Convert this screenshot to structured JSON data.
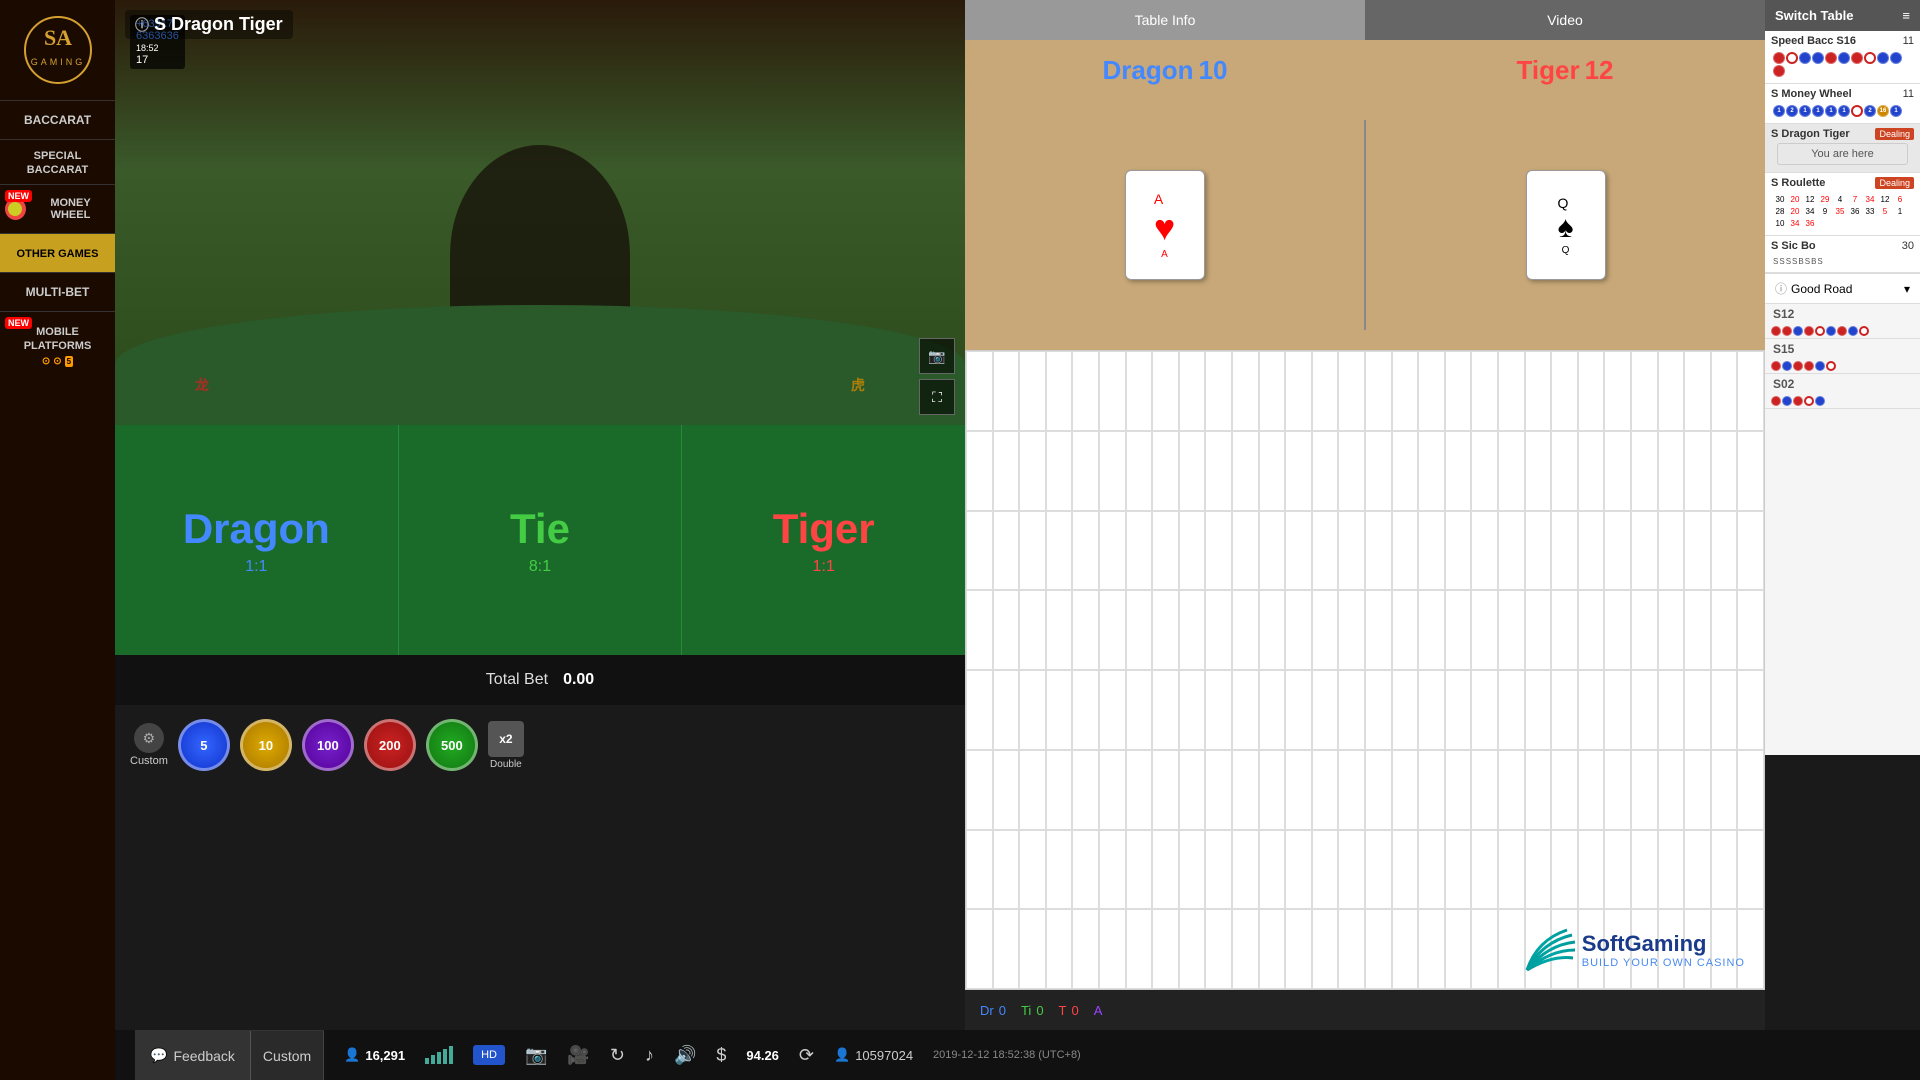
{
  "sidebar": {
    "logo": "SA",
    "logo_sub": "GAMING",
    "nav_items": [
      {
        "id": "baccarat",
        "label": "BACCARAT",
        "active": false
      },
      {
        "id": "special-baccarat",
        "label": "SPECIAL BACCARAT",
        "active": false
      },
      {
        "id": "money-wheel",
        "label": "MONEY WHEEL",
        "active": false,
        "badge": "NEW"
      },
      {
        "id": "other-games",
        "label": "OTHER GAMES",
        "active": true
      },
      {
        "id": "multi-bet",
        "label": "MULTI-BET",
        "active": false
      },
      {
        "id": "mobile-platforms",
        "label": "MOBILE PLATFORMS",
        "active": false,
        "badge": "NEW"
      }
    ]
  },
  "game": {
    "title": "S Dragon Tiger",
    "dragon_score": 10,
    "tiger_score": 12,
    "dragon_card": "♥",
    "tiger_card": "♛",
    "dragon_card_color": "red",
    "tiger_card_color": "black"
  },
  "betting": {
    "dragon_label": "Dragon",
    "dragon_odds": "1:1",
    "tie_label": "Tie",
    "tie_odds": "8:1",
    "tiger_label": "Tiger",
    "tiger_odds": "1:1",
    "total_bet_label": "Total Bet",
    "total_bet_value": "0.00"
  },
  "chips": [
    {
      "value": "5",
      "class": "chip-5"
    },
    {
      "value": "10",
      "class": "chip-10"
    },
    {
      "value": "100",
      "class": "chip-100"
    },
    {
      "value": "200",
      "class": "chip-200"
    },
    {
      "value": "500",
      "class": "chip-500"
    }
  ],
  "scores": {
    "dr_label": "Dr",
    "dr_value": "0",
    "ti_label": "Ti",
    "ti_value": "0",
    "t_label": "T",
    "t_value": "0",
    "a_label": "A"
  },
  "tabs": {
    "table_info": "Table Info",
    "video": "Video"
  },
  "switch_table": {
    "header": "Switch Table",
    "tables": [
      {
        "name": "Speed Bacc S16",
        "count": "11",
        "status": ""
      },
      {
        "name": "S Money Wheel",
        "count": "11",
        "status": ""
      },
      {
        "name": "S Dragon Tiger",
        "count": "",
        "status": "Dealing",
        "active": true
      },
      {
        "name": "S Roulette",
        "count": "",
        "status": "Dealing"
      },
      {
        "name": "S Sic Bo",
        "count": "30",
        "status": ""
      }
    ],
    "you_are_here": "You are here",
    "good_road": "Good Road",
    "side_tables": [
      "S12",
      "S15",
      "S02"
    ]
  },
  "bottom_bar": {
    "balance": "16,291",
    "hd_label": "HD",
    "balance_val": "94.26",
    "user_id": "10597024",
    "datetime": "2019-12-12  18:52:38 (UTC+8)"
  },
  "feedback": {
    "feedback_label": "Feedback",
    "custom_label": "Custom"
  },
  "double_btn": "x2\nDouble",
  "custom_btn_label": "Custom",
  "softgaming": {
    "name": "SoftGaming",
    "tagline": "BUILD YOUR OWN CASINO"
  }
}
